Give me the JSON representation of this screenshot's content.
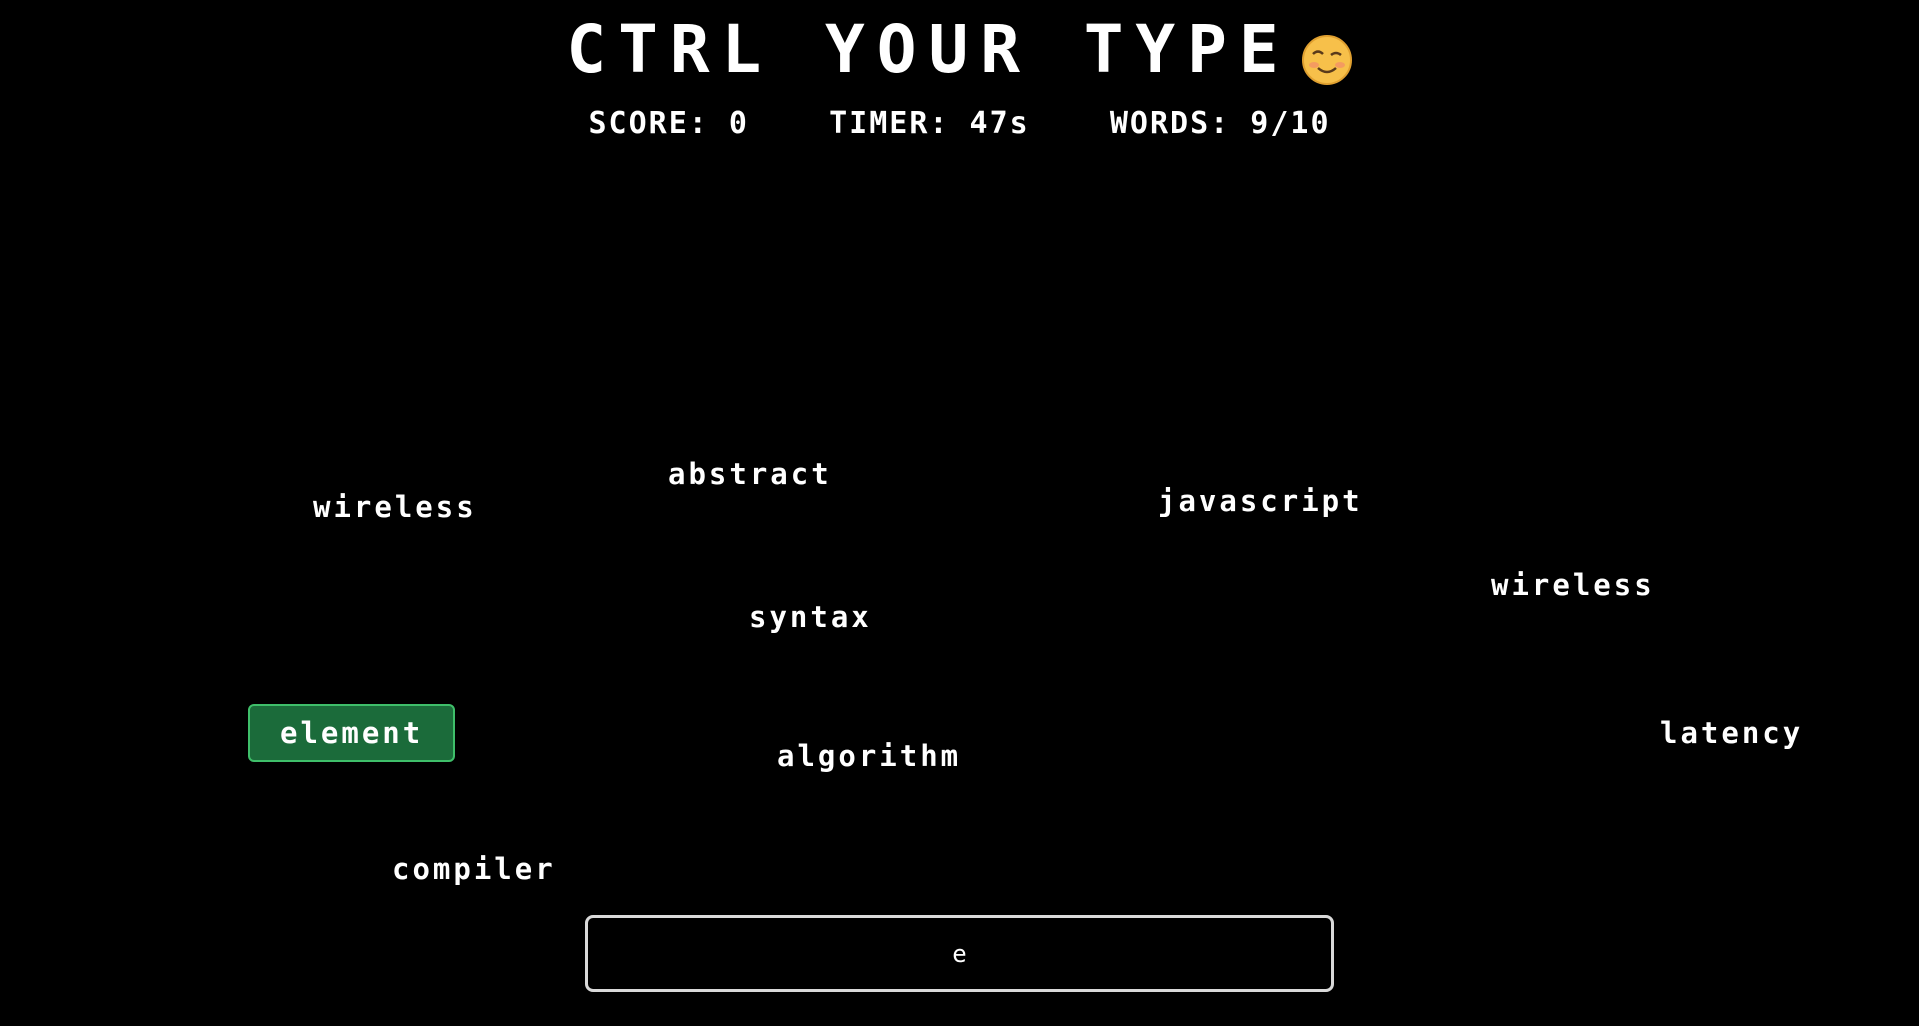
{
  "game": {
    "title": "CTRL YOUR TYPE",
    "emoji_icon": "winking-face-emoji"
  },
  "stats": {
    "score_label": "SCORE:",
    "score_value": "0",
    "timer_label": "TIMER:",
    "timer_value": "47s",
    "words_label": "WORDS:",
    "words_value": "9/10"
  },
  "words": {
    "w0": "wireless",
    "w1": "abstract",
    "w2": "javascript",
    "w3": "wireless",
    "w4": "syntax",
    "w5": "element",
    "w6": "algorithm",
    "w7": "latency",
    "w8": "compiler"
  },
  "active_word": "element",
  "typing_input": {
    "value": "e"
  },
  "colors": {
    "background": "#000000",
    "text": "#ffffff",
    "active_word_bg": "#1b6b3a",
    "active_word_border": "#3fbf6a",
    "input_border": "#d9d9d9"
  }
}
